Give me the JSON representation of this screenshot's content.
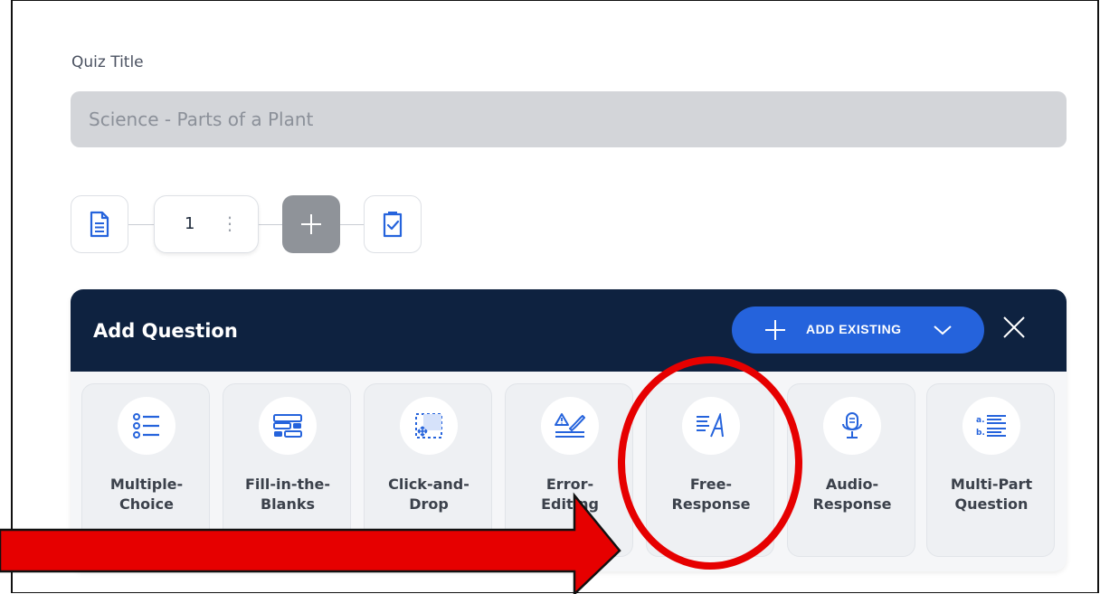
{
  "quiz": {
    "title_label": "Quiz Title",
    "title_value": "Science - Parts of a Plant"
  },
  "pages": {
    "current_page": "1",
    "menu_glyph": "⋮"
  },
  "panel": {
    "title": "Add Question",
    "add_existing_label": "ADD EXISTING"
  },
  "question_types": [
    {
      "label": "Multiple-\nChoice",
      "icon": "list-bullets-icon"
    },
    {
      "label": "Fill-in-the-\nBlanks",
      "icon": "blanks-icon"
    },
    {
      "label": "Click-and-\nDrop",
      "icon": "drag-drop-icon"
    },
    {
      "label": "Error-\nEditing",
      "icon": "error-edit-icon"
    },
    {
      "label": "Free-\nResponse",
      "icon": "free-response-icon"
    },
    {
      "label": "Audio-\nResponse",
      "icon": "microphone-icon"
    },
    {
      "label": "Multi-Part\nQuestion",
      "icon": "multi-part-icon"
    }
  ],
  "colors": {
    "header_bg": "#0e2240",
    "accent_blue": "#2563dc",
    "annotation_red": "#e60000"
  }
}
